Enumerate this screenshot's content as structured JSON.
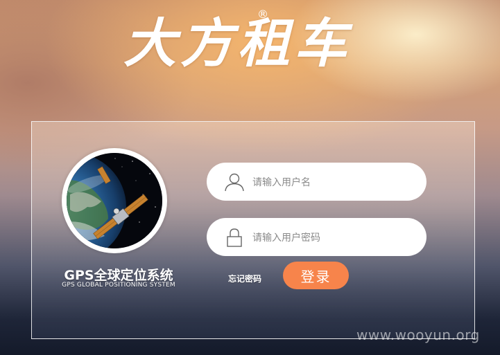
{
  "brand": {
    "logo_text": "大方租车",
    "registered_mark": "®"
  },
  "badge": {
    "title": "GPS全球定位系统",
    "subtitle": "GPS GLOBAL POSITIONING SYSTEM",
    "image_icon": "satellite-earth-icon"
  },
  "form": {
    "username": {
      "placeholder": "请输入用户名",
      "value": "",
      "icon": "user-icon"
    },
    "password": {
      "placeholder": "请输入用户密码",
      "value": "",
      "icon": "lock-icon"
    },
    "forgot_label": "忘记密码",
    "login_label": "登录"
  },
  "colors": {
    "login_button": "#f7844b",
    "field_bg": "#ffffff"
  },
  "watermark": "www.wooyun.org"
}
